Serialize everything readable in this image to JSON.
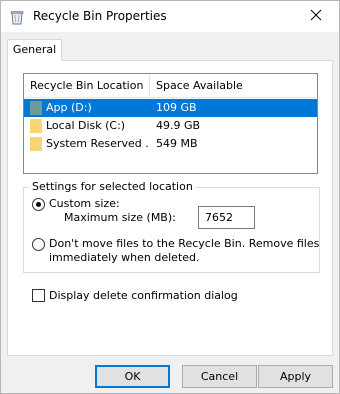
{
  "window": {
    "title": "Recycle Bin Properties",
    "icon": "recycle-bin-icon"
  },
  "tabs": [
    {
      "label": "General",
      "selected": true
    }
  ],
  "list": {
    "columns": [
      "Recycle Bin Location",
      "Space Available"
    ],
    "rows": [
      {
        "location": "App (D:)",
        "space": "109 GB",
        "selected": true,
        "icon": "drive-icon"
      },
      {
        "location": "Local Disk (C:)",
        "space": "49.9 GB",
        "selected": false,
        "icon": "drive-icon"
      },
      {
        "location": "System Reserved ...",
        "space": "549 MB",
        "selected": false,
        "icon": "drive-icon"
      }
    ]
  },
  "settings": {
    "legend": "Settings for selected location",
    "custom_size_label": "Custom size:",
    "custom_size_selected": true,
    "max_size_label": "Maximum size (MB):",
    "max_size_value": "7652",
    "dont_move_line1": "Don't move files to the Recycle Bin. Remove files",
    "dont_move_line2": "immediately when deleted.",
    "dont_move_selected": false
  },
  "confirm_dialog": {
    "label": "Display delete confirmation dialog",
    "checked": false
  },
  "buttons": {
    "ok": "OK",
    "cancel": "Cancel",
    "apply": "Apply"
  },
  "colors": {
    "selection": "#0078d7",
    "folder": "#f7d774",
    "drive_selected": "#6e9a9a"
  }
}
